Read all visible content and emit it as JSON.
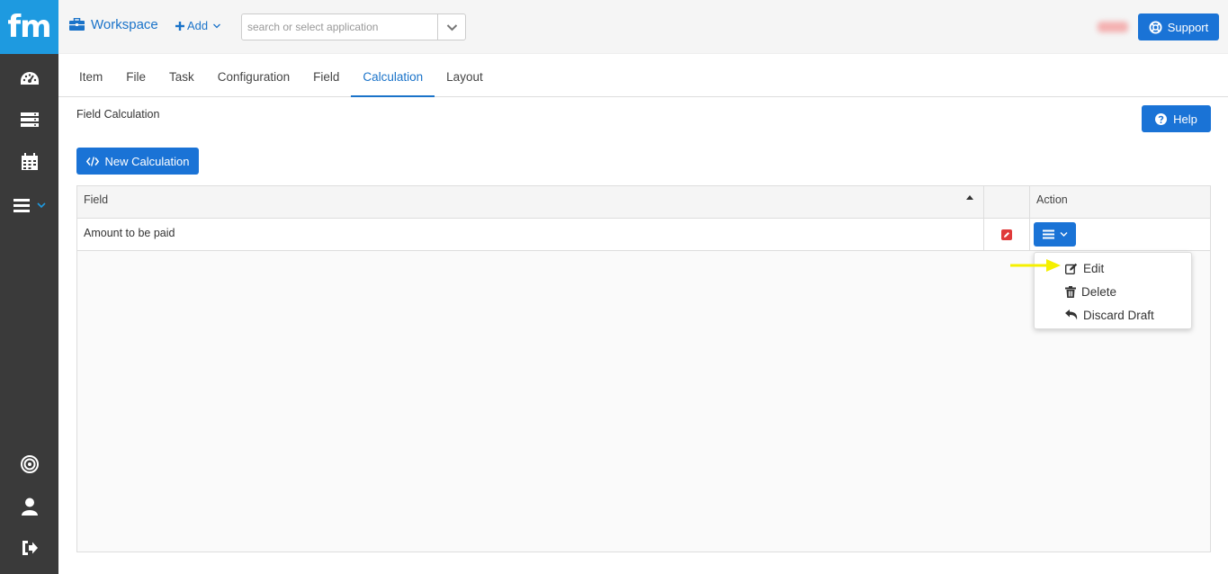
{
  "sidebar": {
    "logo": "fm",
    "items": [
      {
        "name": "dashboard-icon"
      },
      {
        "name": "server-icon"
      },
      {
        "name": "calendar-icon"
      },
      {
        "name": "menu-icon"
      },
      {
        "name": "target-icon"
      },
      {
        "name": "user-icon"
      },
      {
        "name": "logout-icon"
      }
    ]
  },
  "header": {
    "workspace_label": "Workspace",
    "add_label": "Add",
    "search_placeholder": "search or select application",
    "support_label": "Support"
  },
  "tabs": [
    {
      "label": "Item",
      "active": false
    },
    {
      "label": "File",
      "active": false
    },
    {
      "label": "Task",
      "active": false
    },
    {
      "label": "Configuration",
      "active": false
    },
    {
      "label": "Field",
      "active": false
    },
    {
      "label": "Calculation",
      "active": true
    },
    {
      "label": "Layout",
      "active": false
    }
  ],
  "main": {
    "title": "Field Calculation",
    "help_label": "Help",
    "new_calc_label": "New Calculation"
  },
  "table": {
    "columns": [
      "Field",
      "",
      "Action"
    ],
    "rows": [
      {
        "field": "Amount to be paid"
      }
    ]
  },
  "action_menu": {
    "items": [
      {
        "label": "Edit",
        "icon": "edit-icon"
      },
      {
        "label": "Delete",
        "icon": "trash-icon"
      },
      {
        "label": "Discard Draft",
        "icon": "undo-icon"
      }
    ]
  },
  "colors": {
    "brand": "#1e9ae0",
    "primary": "#1a73d6",
    "sidebar": "#3a3a3a",
    "edit_badge": "#e03a3a",
    "pointer_arrow": "#f5f000"
  }
}
